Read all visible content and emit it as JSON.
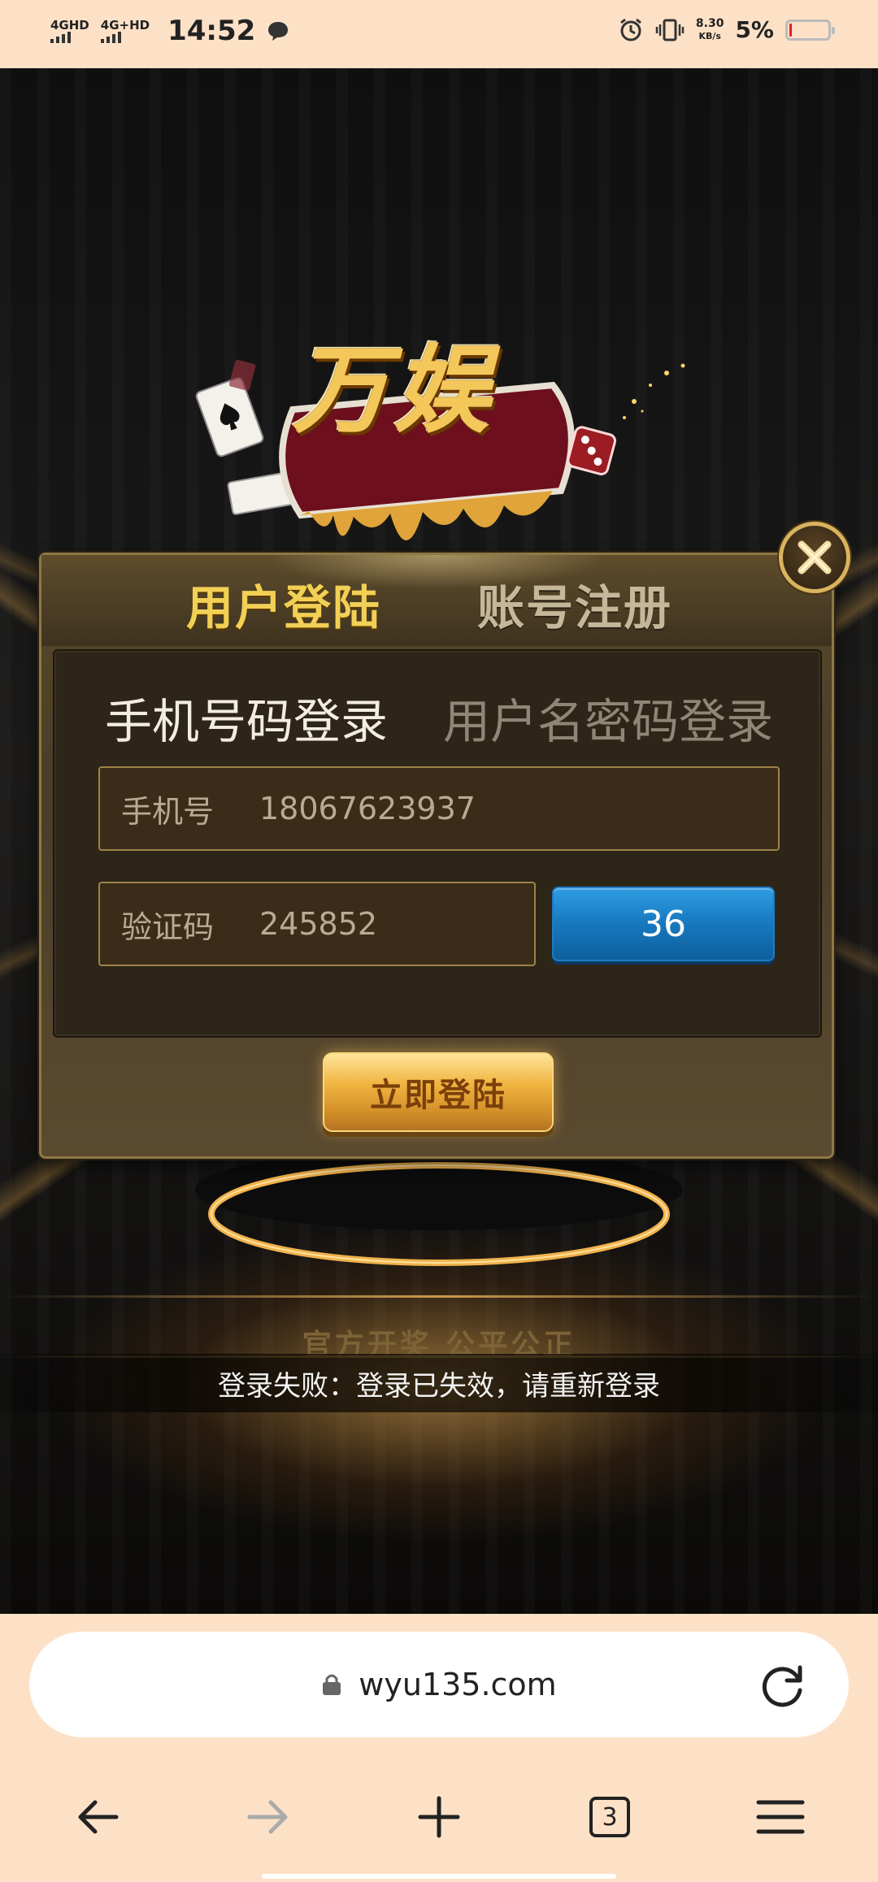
{
  "status_bar": {
    "network_1": "4GHD",
    "network_2": "4G+HD",
    "time": "14:52",
    "speed_value": "8.30",
    "speed_unit": "KB/s",
    "battery_percent": "5%"
  },
  "game": {
    "logo_text": "万娱",
    "tabs": {
      "login": "用户登陆",
      "register": "账号注册"
    },
    "subtabs": {
      "phone_login": "手机号码登录",
      "username_login": "用户名密码登录"
    },
    "phone_field": {
      "label": "手机号",
      "value": "18067623937"
    },
    "code_field": {
      "label": "验证码",
      "value": "245852"
    },
    "code_button": "36",
    "login_button": "立即登陆",
    "background_slogan": "官方开奖 公平公正",
    "toast": "登录失败：登录已失效，请重新登录"
  },
  "browser": {
    "url": "wyu135.com",
    "tab_count": "3"
  },
  "colors": {
    "status_bg": "#fde1c6",
    "active_tab": "#f2d055",
    "code_button": "#1778be",
    "login_button": "#f0b440"
  }
}
